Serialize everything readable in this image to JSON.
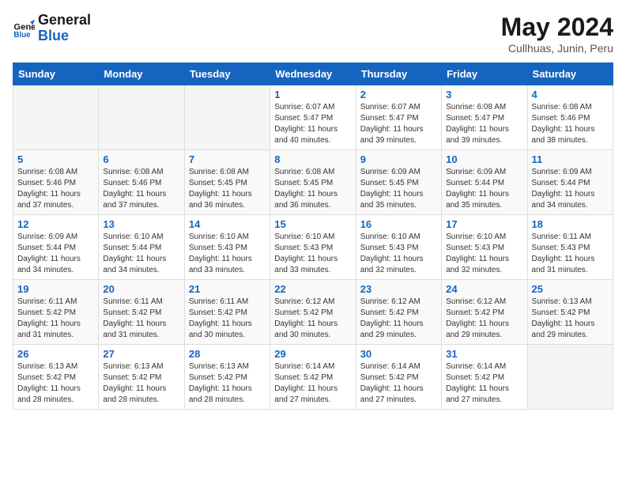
{
  "header": {
    "logo_line1": "General",
    "logo_line2": "Blue",
    "month_year": "May 2024",
    "location": "Cullhuas, Junin, Peru"
  },
  "weekdays": [
    "Sunday",
    "Monday",
    "Tuesday",
    "Wednesday",
    "Thursday",
    "Friday",
    "Saturday"
  ],
  "weeks": [
    [
      {
        "day": "",
        "sunrise": "",
        "sunset": "",
        "daylight": ""
      },
      {
        "day": "",
        "sunrise": "",
        "sunset": "",
        "daylight": ""
      },
      {
        "day": "",
        "sunrise": "",
        "sunset": "",
        "daylight": ""
      },
      {
        "day": "1",
        "sunrise": "6:07 AM",
        "sunset": "5:47 PM",
        "daylight": "11 hours and 40 minutes."
      },
      {
        "day": "2",
        "sunrise": "6:07 AM",
        "sunset": "5:47 PM",
        "daylight": "11 hours and 39 minutes."
      },
      {
        "day": "3",
        "sunrise": "6:08 AM",
        "sunset": "5:47 PM",
        "daylight": "11 hours and 39 minutes."
      },
      {
        "day": "4",
        "sunrise": "6:08 AM",
        "sunset": "5:46 PM",
        "daylight": "11 hours and 38 minutes."
      }
    ],
    [
      {
        "day": "5",
        "sunrise": "6:08 AM",
        "sunset": "5:46 PM",
        "daylight": "11 hours and 37 minutes."
      },
      {
        "day": "6",
        "sunrise": "6:08 AM",
        "sunset": "5:46 PM",
        "daylight": "11 hours and 37 minutes."
      },
      {
        "day": "7",
        "sunrise": "6:08 AM",
        "sunset": "5:45 PM",
        "daylight": "11 hours and 36 minutes."
      },
      {
        "day": "8",
        "sunrise": "6:08 AM",
        "sunset": "5:45 PM",
        "daylight": "11 hours and 36 minutes."
      },
      {
        "day": "9",
        "sunrise": "6:09 AM",
        "sunset": "5:45 PM",
        "daylight": "11 hours and 35 minutes."
      },
      {
        "day": "10",
        "sunrise": "6:09 AM",
        "sunset": "5:44 PM",
        "daylight": "11 hours and 35 minutes."
      },
      {
        "day": "11",
        "sunrise": "6:09 AM",
        "sunset": "5:44 PM",
        "daylight": "11 hours and 34 minutes."
      }
    ],
    [
      {
        "day": "12",
        "sunrise": "6:09 AM",
        "sunset": "5:44 PM",
        "daylight": "11 hours and 34 minutes."
      },
      {
        "day": "13",
        "sunrise": "6:10 AM",
        "sunset": "5:44 PM",
        "daylight": "11 hours and 34 minutes."
      },
      {
        "day": "14",
        "sunrise": "6:10 AM",
        "sunset": "5:43 PM",
        "daylight": "11 hours and 33 minutes."
      },
      {
        "day": "15",
        "sunrise": "6:10 AM",
        "sunset": "5:43 PM",
        "daylight": "11 hours and 33 minutes."
      },
      {
        "day": "16",
        "sunrise": "6:10 AM",
        "sunset": "5:43 PM",
        "daylight": "11 hours and 32 minutes."
      },
      {
        "day": "17",
        "sunrise": "6:10 AM",
        "sunset": "5:43 PM",
        "daylight": "11 hours and 32 minutes."
      },
      {
        "day": "18",
        "sunrise": "6:11 AM",
        "sunset": "5:43 PM",
        "daylight": "11 hours and 31 minutes."
      }
    ],
    [
      {
        "day": "19",
        "sunrise": "6:11 AM",
        "sunset": "5:42 PM",
        "daylight": "11 hours and 31 minutes."
      },
      {
        "day": "20",
        "sunrise": "6:11 AM",
        "sunset": "5:42 PM",
        "daylight": "11 hours and 31 minutes."
      },
      {
        "day": "21",
        "sunrise": "6:11 AM",
        "sunset": "5:42 PM",
        "daylight": "11 hours and 30 minutes."
      },
      {
        "day": "22",
        "sunrise": "6:12 AM",
        "sunset": "5:42 PM",
        "daylight": "11 hours and 30 minutes."
      },
      {
        "day": "23",
        "sunrise": "6:12 AM",
        "sunset": "5:42 PM",
        "daylight": "11 hours and 29 minutes."
      },
      {
        "day": "24",
        "sunrise": "6:12 AM",
        "sunset": "5:42 PM",
        "daylight": "11 hours and 29 minutes."
      },
      {
        "day": "25",
        "sunrise": "6:13 AM",
        "sunset": "5:42 PM",
        "daylight": "11 hours and 29 minutes."
      }
    ],
    [
      {
        "day": "26",
        "sunrise": "6:13 AM",
        "sunset": "5:42 PM",
        "daylight": "11 hours and 28 minutes."
      },
      {
        "day": "27",
        "sunrise": "6:13 AM",
        "sunset": "5:42 PM",
        "daylight": "11 hours and 28 minutes."
      },
      {
        "day": "28",
        "sunrise": "6:13 AM",
        "sunset": "5:42 PM",
        "daylight": "11 hours and 28 minutes."
      },
      {
        "day": "29",
        "sunrise": "6:14 AM",
        "sunset": "5:42 PM",
        "daylight": "11 hours and 27 minutes."
      },
      {
        "day": "30",
        "sunrise": "6:14 AM",
        "sunset": "5:42 PM",
        "daylight": "11 hours and 27 minutes."
      },
      {
        "day": "31",
        "sunrise": "6:14 AM",
        "sunset": "5:42 PM",
        "daylight": "11 hours and 27 minutes."
      },
      {
        "day": "",
        "sunrise": "",
        "sunset": "",
        "daylight": ""
      }
    ]
  ]
}
